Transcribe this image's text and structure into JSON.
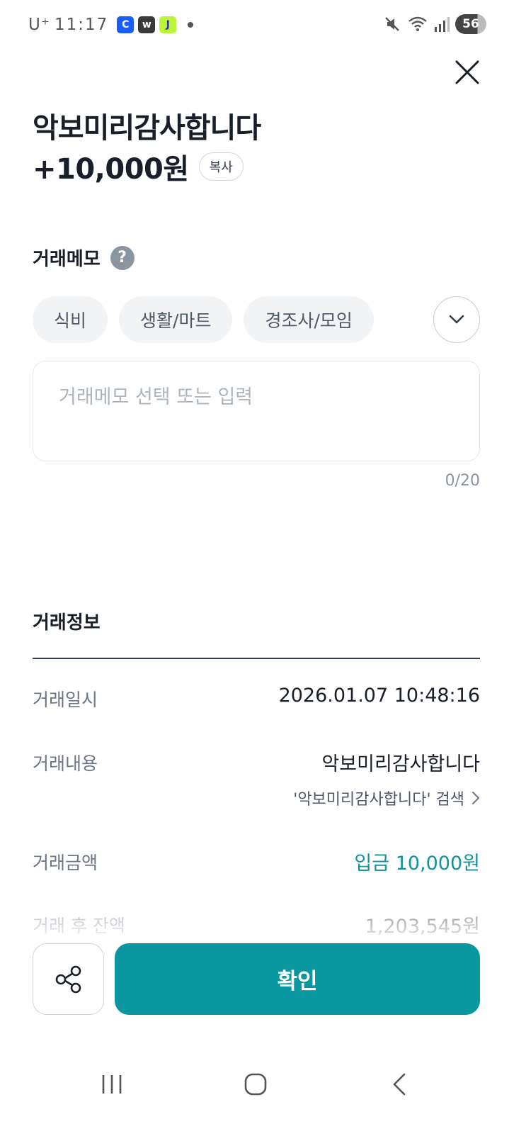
{
  "status_bar": {
    "carrier": "U⁺",
    "time": "11:17",
    "app_icons": [
      {
        "name": "refresh-app-icon",
        "glyph": "C"
      },
      {
        "name": "w-app-icon",
        "glyph": "w"
      },
      {
        "name": "lime-app-icon",
        "glyph": "J"
      }
    ],
    "battery": "56"
  },
  "header": {
    "title": "악보미리감사합니다",
    "amount": "+10,000원",
    "copy_label": "복사"
  },
  "memo": {
    "label": "거래메모",
    "help_glyph": "?",
    "chips": [
      "식비",
      "생활/마트",
      "경조사/모임"
    ],
    "placeholder": "거래메모 선택 또는 입력",
    "count": "0/20"
  },
  "info": {
    "title": "거래정보",
    "date_label": "거래일시",
    "date_value": "2026.01.07 10:48:16",
    "desc_label": "거래내용",
    "desc_value": "악보미리감사합니다",
    "search_link": "'악보미리감사합니다' 검색",
    "amount_label": "거래금액",
    "amount_value": "입금 10,000원",
    "balance_label": "거래 후 잔액",
    "balance_value": "1,203,545원"
  },
  "actions": {
    "confirm_label": "확인"
  },
  "colors": {
    "accent": "#0a97a0",
    "deposit_text": "#12939c",
    "chip_bg": "#f2f4f6"
  }
}
